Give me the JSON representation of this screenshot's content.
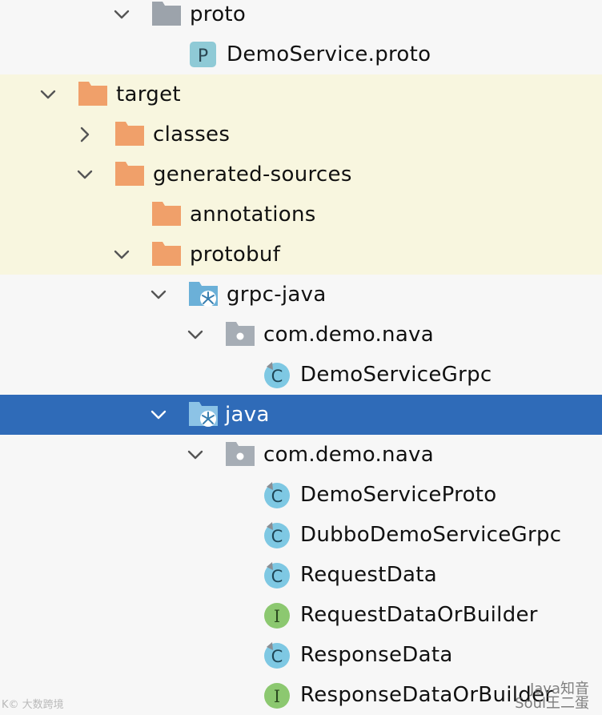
{
  "tree": {
    "items": [
      {
        "label": "proto",
        "icon": "gray-folder-icon",
        "expanded": true
      },
      {
        "label": "DemoService.proto",
        "icon": "proto-file-icon",
        "badge": "P"
      },
      {
        "label": "target",
        "icon": "orange-folder-icon",
        "expanded": true
      },
      {
        "label": "classes",
        "icon": "orange-folder-icon",
        "expanded": false
      },
      {
        "label": "generated-sources",
        "icon": "orange-folder-icon",
        "expanded": true
      },
      {
        "label": "annotations",
        "icon": "orange-folder-icon"
      },
      {
        "label": "protobuf",
        "icon": "orange-folder-icon",
        "expanded": true
      },
      {
        "label": "grpc-java",
        "icon": "source-root-folder-icon",
        "expanded": true
      },
      {
        "label": "com.demo.nava",
        "icon": "package-icon",
        "expanded": true
      },
      {
        "label": "DemoServiceGrpc",
        "icon": "class-icon",
        "badge": "C"
      },
      {
        "label": "java",
        "icon": "source-root-folder-icon",
        "expanded": true,
        "selected": true
      },
      {
        "label": "com.demo.nava",
        "icon": "package-icon",
        "expanded": true
      },
      {
        "label": "DemoServiceProto",
        "icon": "class-icon",
        "badge": "C"
      },
      {
        "label": "DubboDemoServiceGrpc",
        "icon": "class-icon",
        "badge": "C"
      },
      {
        "label": "RequestData",
        "icon": "class-icon",
        "badge": "C"
      },
      {
        "label": "RequestDataOrBuilder",
        "icon": "interface-icon",
        "badge": "I"
      },
      {
        "label": "ResponseData",
        "icon": "class-icon",
        "badge": "C"
      },
      {
        "label": "ResponseDataOrBuilder",
        "icon": "interface-icon",
        "badge": "I"
      }
    ]
  },
  "watermarks": {
    "left": "K© 大数跨境",
    "right_line1": "Java知音",
    "right_line2": "Soul王二蛋"
  },
  "colors": {
    "selection": "#2f6bb8",
    "excluded_background": "#f8f6df",
    "folder_orange": "#f0a06a",
    "folder_gray": "#9ca3ab",
    "class_blue": "#7ec8e3",
    "interface_green": "#8cc870"
  }
}
